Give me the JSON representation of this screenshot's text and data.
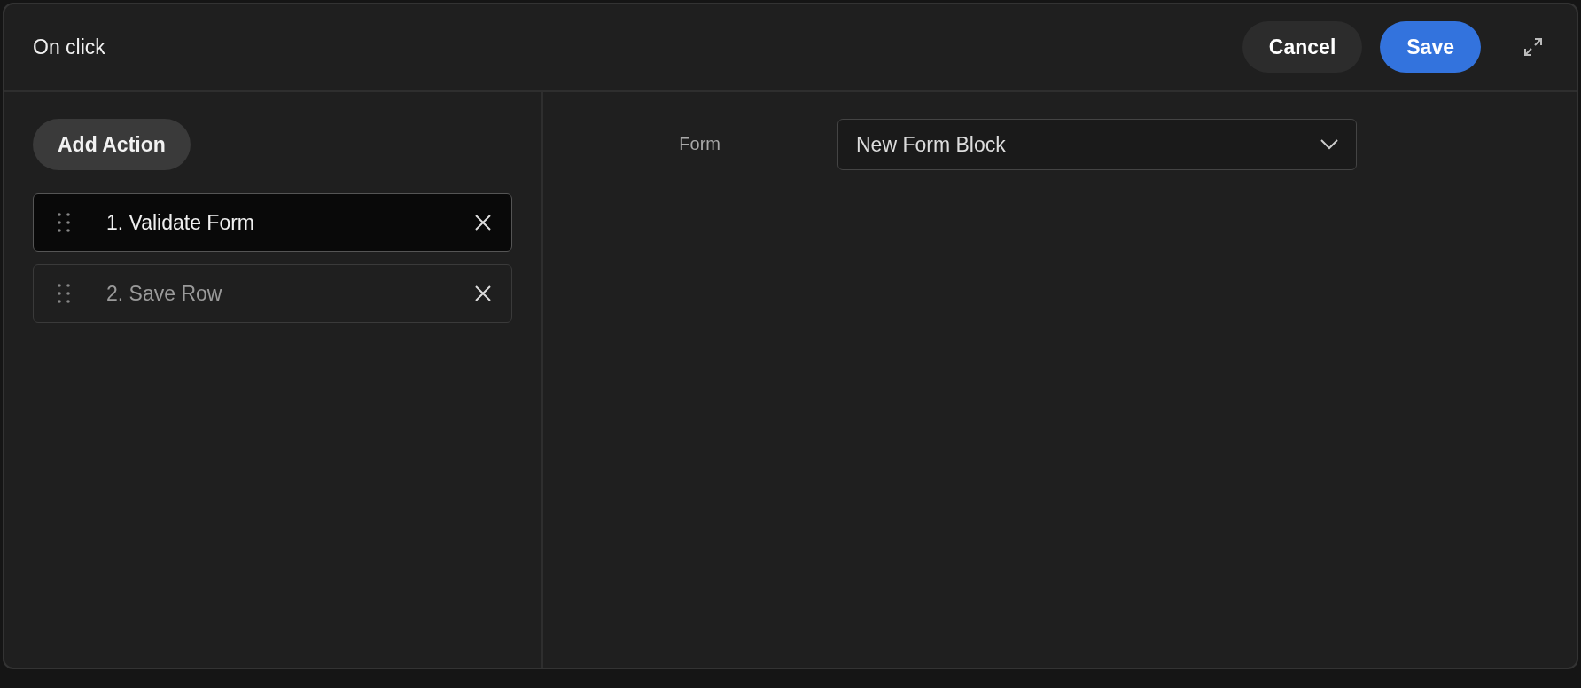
{
  "dialog": {
    "title": "On click",
    "buttons": [
      {
        "label": "Cancel",
        "kind": "secondary"
      },
      {
        "label": "Save",
        "kind": "primary"
      }
    ]
  },
  "sidebar": {
    "add_button": "Add Action",
    "actions": [
      {
        "label": "1. Validate Form",
        "selected": true
      },
      {
        "label": "2. Save Row",
        "selected": false
      }
    ]
  },
  "form": {
    "label": "Form",
    "value": "New Form Block"
  }
}
